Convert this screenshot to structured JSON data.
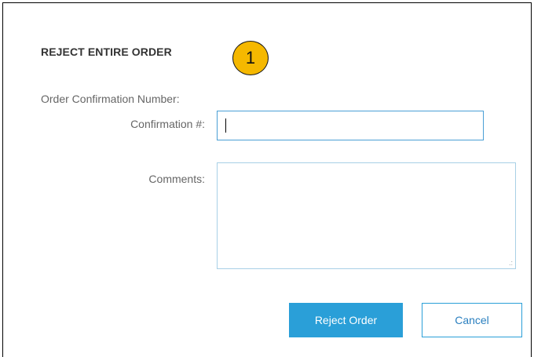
{
  "dialog": {
    "title": "REJECT ENTIRE ORDER",
    "step_badge": "1",
    "section_label": "Order Confirmation Number:"
  },
  "form": {
    "confirmation_label": "Confirmation #:",
    "confirmation_value": "",
    "comments_label": "Comments:",
    "comments_value": ""
  },
  "actions": {
    "reject_label": "Reject Order",
    "cancel_label": "Cancel"
  },
  "colors": {
    "accent": "#2a9fd8",
    "badge": "#f5b800",
    "label_text": "#666666"
  },
  "icons": {
    "textarea_grip": "resize-grip-icon"
  }
}
